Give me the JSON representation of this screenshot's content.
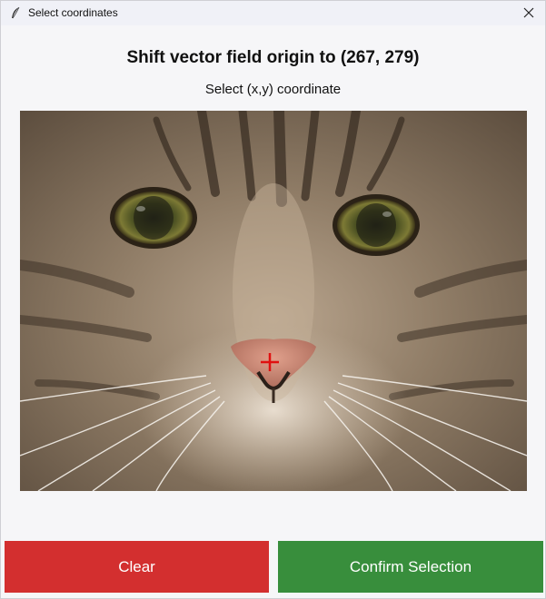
{
  "window": {
    "title": "Select coordinates",
    "app_icon": "feather-icon",
    "close_icon": "close-icon"
  },
  "main": {
    "heading": "Shift vector field origin to (267, 279)",
    "subheading": "Select (x,y) coordinate",
    "image": {
      "subject": "cat-face-photo",
      "marker_icon": "crosshair-icon",
      "marker_color": "#e01010"
    }
  },
  "buttons": {
    "clear_label": "Clear",
    "confirm_label": "Confirm Selection",
    "clear_color": "#d32f2f",
    "confirm_color": "#388e3c"
  }
}
